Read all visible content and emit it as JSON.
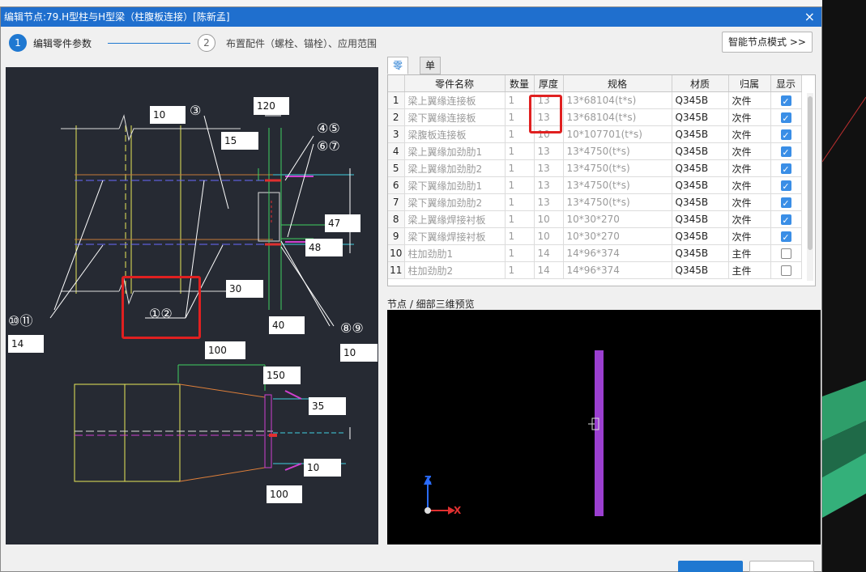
{
  "window": {
    "title": "编辑节点:79.H型柱与H型梁（柱腹板连接）[陈新孟]",
    "close_glyph": "×"
  },
  "steps": [
    {
      "number": "1",
      "label": "编辑零件参数",
      "active": true
    },
    {
      "number": "2",
      "label": "布置配件（螺栓、锚栓）、应用范围",
      "active": false
    }
  ],
  "smart_mode_button": "智能节点模式 >>",
  "diagram": {
    "labels": {
      "top_dim_10": "10",
      "part_3": "③",
      "dim_120": "120",
      "dim_15": "15",
      "part_45": "④⑤",
      "part_67": "⑥⑦",
      "dim_47": "47",
      "dim_48": "48",
      "dim_30": "30",
      "part_12": "①②",
      "part_1011": "⑩⑪",
      "dim_14": "14",
      "dim_40": "40",
      "part_89": "⑧⑨",
      "dim_10b": "10",
      "dim_100": "100",
      "dim_150": "150",
      "dim_35": "35",
      "dim_10c": "10",
      "dim_100b": "100"
    }
  },
  "tabs": [
    "零件",
    "单构件"
  ],
  "table": {
    "headers": [
      "",
      "零件名称",
      "数量",
      "厚度",
      "规格",
      "材质",
      "归属",
      "显示"
    ],
    "rows": [
      {
        "idx": "1",
        "name": "梁上翼缘连接板",
        "qty": "1",
        "thick": "13",
        "spec": "13*68104(t*s)",
        "mat": "Q345B",
        "owner": "次件",
        "show": true
      },
      {
        "idx": "2",
        "name": "梁下翼缘连接板",
        "qty": "1",
        "thick": "13",
        "spec": "13*68104(t*s)",
        "mat": "Q345B",
        "owner": "次件",
        "show": true
      },
      {
        "idx": "3",
        "name": "梁腹板连接板",
        "qty": "1",
        "thick": "10",
        "spec": "10*107701(t*s)",
        "mat": "Q345B",
        "owner": "次件",
        "show": true
      },
      {
        "idx": "4",
        "name": "梁上翼缘加劲肋1",
        "qty": "1",
        "thick": "13",
        "spec": "13*4750(t*s)",
        "mat": "Q345B",
        "owner": "次件",
        "show": true
      },
      {
        "idx": "5",
        "name": "梁上翼缘加劲肋2",
        "qty": "1",
        "thick": "13",
        "spec": "13*4750(t*s)",
        "mat": "Q345B",
        "owner": "次件",
        "show": true
      },
      {
        "idx": "6",
        "name": "梁下翼缘加劲肋1",
        "qty": "1",
        "thick": "13",
        "spec": "13*4750(t*s)",
        "mat": "Q345B",
        "owner": "次件",
        "show": true
      },
      {
        "idx": "7",
        "name": "梁下翼缘加劲肋2",
        "qty": "1",
        "thick": "13",
        "spec": "13*4750(t*s)",
        "mat": "Q345B",
        "owner": "次件",
        "show": true
      },
      {
        "idx": "8",
        "name": "梁上翼缘焊接衬板",
        "qty": "1",
        "thick": "10",
        "spec": "10*30*270",
        "mat": "Q345B",
        "owner": "次件",
        "show": true
      },
      {
        "idx": "9",
        "name": "梁下翼缘焊接衬板",
        "qty": "1",
        "thick": "10",
        "spec": "10*30*270",
        "mat": "Q345B",
        "owner": "次件",
        "show": true
      },
      {
        "idx": "10",
        "name": "柱加劲肋1",
        "qty": "1",
        "thick": "14",
        "spec": "14*96*374",
        "mat": "Q345B",
        "owner": "主件",
        "show": false
      },
      {
        "idx": "11",
        "name": "柱加劲肋2",
        "qty": "1",
        "thick": "14",
        "spec": "14*96*374",
        "mat": "Q345B",
        "owner": "主件",
        "show": false
      }
    ]
  },
  "preview": {
    "label": "节点 / 细部三维预览",
    "axis_z": "Z",
    "axis_x": "X"
  },
  "colors": {
    "title_bar": "#1f6fce",
    "highlight_red": "#e02020",
    "checkbox_blue": "#3a8ee6",
    "preview_member": "#9b3fd0"
  }
}
